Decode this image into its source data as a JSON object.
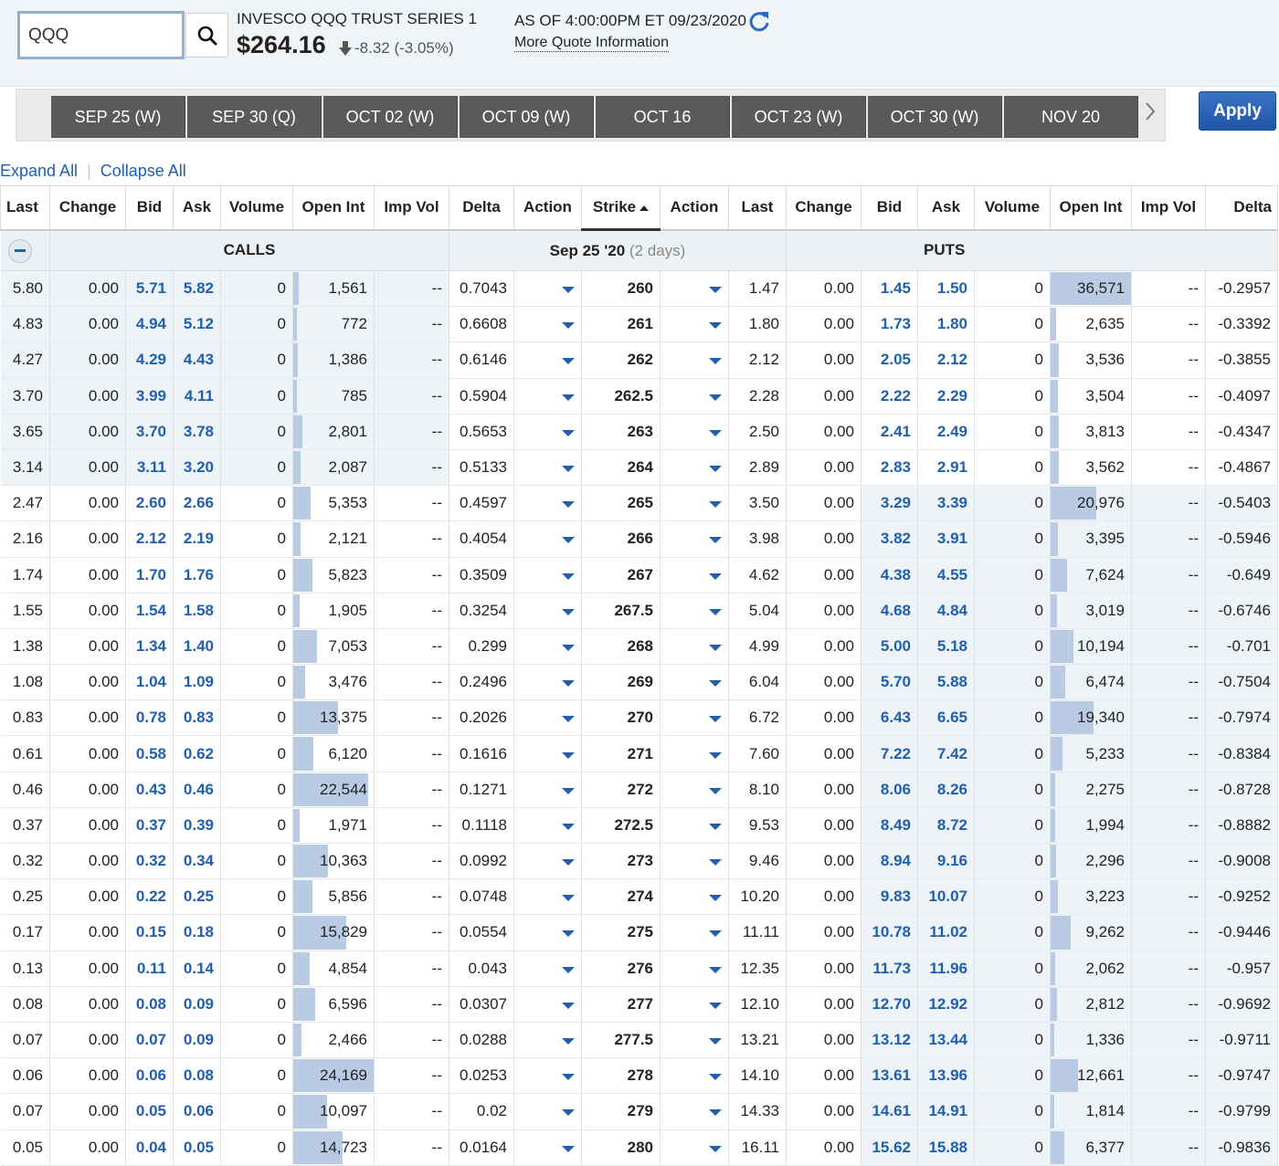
{
  "quote": {
    "symbol": "QQQ",
    "name": "INVESCO QQQ TRUST SERIES 1",
    "price": "$264.16",
    "change": "-8.32 (-3.05%)",
    "as_of": "AS OF 4:00:00PM ET 09/23/2020",
    "more_link": "More Quote Information"
  },
  "expirations": [
    "SEP 25 (W)",
    "SEP 30 (Q)",
    "OCT 02 (W)",
    "OCT 09 (W)",
    "OCT 16",
    "OCT 23 (W)",
    "OCT 30 (W)",
    "NOV 20"
  ],
  "apply_label": "Apply",
  "links": {
    "expand": "Expand All",
    "collapse": "Collapse All"
  },
  "columns": [
    "Last",
    "Change",
    "Bid",
    "Ask",
    "Volume",
    "Open Int",
    "Imp Vol",
    "Delta",
    "Action",
    "Strike",
    "Action",
    "Last",
    "Change",
    "Bid",
    "Ask",
    "Volume",
    "Open Int",
    "Imp Vol",
    "Delta"
  ],
  "group": {
    "calls": "CALLS",
    "puts": "PUTS",
    "expiry": "Sep 25 '20",
    "days": "(2 days)"
  },
  "rows": [
    {
      "strike": "260",
      "call": {
        "last": "5.80",
        "change": "0.00",
        "bid": "5.71",
        "ask": "5.82",
        "volume": "0",
        "oi": "1,561",
        "iv": "--",
        "delta": "0.7043"
      },
      "put": {
        "last": "1.47",
        "change": "0.00",
        "bid": "1.45",
        "ask": "1.50",
        "volume": "0",
        "oi": "36,571",
        "iv": "--",
        "delta": "-0.2957"
      }
    },
    {
      "strike": "261",
      "call": {
        "last": "4.83",
        "change": "0.00",
        "bid": "4.94",
        "ask": "5.12",
        "volume": "0",
        "oi": "772",
        "iv": "--",
        "delta": "0.6608"
      },
      "put": {
        "last": "1.80",
        "change": "0.00",
        "bid": "1.73",
        "ask": "1.80",
        "volume": "0",
        "oi": "2,635",
        "iv": "--",
        "delta": "-0.3392"
      }
    },
    {
      "strike": "262",
      "call": {
        "last": "4.27",
        "change": "0.00",
        "bid": "4.29",
        "ask": "4.43",
        "volume": "0",
        "oi": "1,386",
        "iv": "--",
        "delta": "0.6146"
      },
      "put": {
        "last": "2.12",
        "change": "0.00",
        "bid": "2.05",
        "ask": "2.12",
        "volume": "0",
        "oi": "3,536",
        "iv": "--",
        "delta": "-0.3855"
      }
    },
    {
      "strike": "262.5",
      "call": {
        "last": "3.70",
        "change": "0.00",
        "bid": "3.99",
        "ask": "4.11",
        "volume": "0",
        "oi": "785",
        "iv": "--",
        "delta": "0.5904"
      },
      "put": {
        "last": "2.28",
        "change": "0.00",
        "bid": "2.22",
        "ask": "2.29",
        "volume": "0",
        "oi": "3,504",
        "iv": "--",
        "delta": "-0.4097"
      }
    },
    {
      "strike": "263",
      "call": {
        "last": "3.65",
        "change": "0.00",
        "bid": "3.70",
        "ask": "3.78",
        "volume": "0",
        "oi": "2,801",
        "iv": "--",
        "delta": "0.5653"
      },
      "put": {
        "last": "2.50",
        "change": "0.00",
        "bid": "2.41",
        "ask": "2.49",
        "volume": "0",
        "oi": "3,813",
        "iv": "--",
        "delta": "-0.4347"
      }
    },
    {
      "strike": "264",
      "call": {
        "last": "3.14",
        "change": "0.00",
        "bid": "3.11",
        "ask": "3.20",
        "volume": "0",
        "oi": "2,087",
        "iv": "--",
        "delta": "0.5133"
      },
      "put": {
        "last": "2.89",
        "change": "0.00",
        "bid": "2.83",
        "ask": "2.91",
        "volume": "0",
        "oi": "3,562",
        "iv": "--",
        "delta": "-0.4867"
      }
    },
    {
      "strike": "265",
      "call": {
        "last": "2.47",
        "change": "0.00",
        "bid": "2.60",
        "ask": "2.66",
        "volume": "0",
        "oi": "5,353",
        "iv": "--",
        "delta": "0.4597"
      },
      "put": {
        "last": "3.50",
        "change": "0.00",
        "bid": "3.29",
        "ask": "3.39",
        "volume": "0",
        "oi": "20,976",
        "iv": "--",
        "delta": "-0.5403"
      }
    },
    {
      "strike": "266",
      "call": {
        "last": "2.16",
        "change": "0.00",
        "bid": "2.12",
        "ask": "2.19",
        "volume": "0",
        "oi": "2,121",
        "iv": "--",
        "delta": "0.4054"
      },
      "put": {
        "last": "3.98",
        "change": "0.00",
        "bid": "3.82",
        "ask": "3.91",
        "volume": "0",
        "oi": "3,395",
        "iv": "--",
        "delta": "-0.5946"
      }
    },
    {
      "strike": "267",
      "call": {
        "last": "1.74",
        "change": "0.00",
        "bid": "1.70",
        "ask": "1.76",
        "volume": "0",
        "oi": "5,823",
        "iv": "--",
        "delta": "0.3509"
      },
      "put": {
        "last": "4.62",
        "change": "0.00",
        "bid": "4.38",
        "ask": "4.55",
        "volume": "0",
        "oi": "7,624",
        "iv": "--",
        "delta": "-0.649"
      }
    },
    {
      "strike": "267.5",
      "call": {
        "last": "1.55",
        "change": "0.00",
        "bid": "1.54",
        "ask": "1.58",
        "volume": "0",
        "oi": "1,905",
        "iv": "--",
        "delta": "0.3254"
      },
      "put": {
        "last": "5.04",
        "change": "0.00",
        "bid": "4.68",
        "ask": "4.84",
        "volume": "0",
        "oi": "3,019",
        "iv": "--",
        "delta": "-0.6746"
      }
    },
    {
      "strike": "268",
      "call": {
        "last": "1.38",
        "change": "0.00",
        "bid": "1.34",
        "ask": "1.40",
        "volume": "0",
        "oi": "7,053",
        "iv": "--",
        "delta": "0.299"
      },
      "put": {
        "last": "4.99",
        "change": "0.00",
        "bid": "5.00",
        "ask": "5.18",
        "volume": "0",
        "oi": "10,194",
        "iv": "--",
        "delta": "-0.701"
      }
    },
    {
      "strike": "269",
      "call": {
        "last": "1.08",
        "change": "0.00",
        "bid": "1.04",
        "ask": "1.09",
        "volume": "0",
        "oi": "3,476",
        "iv": "--",
        "delta": "0.2496"
      },
      "put": {
        "last": "6.04",
        "change": "0.00",
        "bid": "5.70",
        "ask": "5.88",
        "volume": "0",
        "oi": "6,474",
        "iv": "--",
        "delta": "-0.7504"
      }
    },
    {
      "strike": "270",
      "call": {
        "last": "0.83",
        "change": "0.00",
        "bid": "0.78",
        "ask": "0.83",
        "volume": "0",
        "oi": "13,375",
        "iv": "--",
        "delta": "0.2026"
      },
      "put": {
        "last": "6.72",
        "change": "0.00",
        "bid": "6.43",
        "ask": "6.65",
        "volume": "0",
        "oi": "19,340",
        "iv": "--",
        "delta": "-0.7974"
      }
    },
    {
      "strike": "271",
      "call": {
        "last": "0.61",
        "change": "0.00",
        "bid": "0.58",
        "ask": "0.62",
        "volume": "0",
        "oi": "6,120",
        "iv": "--",
        "delta": "0.1616"
      },
      "put": {
        "last": "7.60",
        "change": "0.00",
        "bid": "7.22",
        "ask": "7.42",
        "volume": "0",
        "oi": "5,233",
        "iv": "--",
        "delta": "-0.8384"
      }
    },
    {
      "strike": "272",
      "call": {
        "last": "0.46",
        "change": "0.00",
        "bid": "0.43",
        "ask": "0.46",
        "volume": "0",
        "oi": "22,544",
        "iv": "--",
        "delta": "0.1271"
      },
      "put": {
        "last": "8.10",
        "change": "0.00",
        "bid": "8.06",
        "ask": "8.26",
        "volume": "0",
        "oi": "2,275",
        "iv": "--",
        "delta": "-0.8728"
      }
    },
    {
      "strike": "272.5",
      "call": {
        "last": "0.37",
        "change": "0.00",
        "bid": "0.37",
        "ask": "0.39",
        "volume": "0",
        "oi": "1,971",
        "iv": "--",
        "delta": "0.1118"
      },
      "put": {
        "last": "9.53",
        "change": "0.00",
        "bid": "8.49",
        "ask": "8.72",
        "volume": "0",
        "oi": "1,994",
        "iv": "--",
        "delta": "-0.8882"
      }
    },
    {
      "strike": "273",
      "call": {
        "last": "0.32",
        "change": "0.00",
        "bid": "0.32",
        "ask": "0.34",
        "volume": "0",
        "oi": "10,363",
        "iv": "--",
        "delta": "0.0992"
      },
      "put": {
        "last": "9.46",
        "change": "0.00",
        "bid": "8.94",
        "ask": "9.16",
        "volume": "0",
        "oi": "2,296",
        "iv": "--",
        "delta": "-0.9008"
      }
    },
    {
      "strike": "274",
      "call": {
        "last": "0.25",
        "change": "0.00",
        "bid": "0.22",
        "ask": "0.25",
        "volume": "0",
        "oi": "5,856",
        "iv": "--",
        "delta": "0.0748"
      },
      "put": {
        "last": "10.20",
        "change": "0.00",
        "bid": "9.83",
        "ask": "10.07",
        "volume": "0",
        "oi": "3,223",
        "iv": "--",
        "delta": "-0.9252"
      }
    },
    {
      "strike": "275",
      "call": {
        "last": "0.17",
        "change": "0.00",
        "bid": "0.15",
        "ask": "0.18",
        "volume": "0",
        "oi": "15,829",
        "iv": "--",
        "delta": "0.0554"
      },
      "put": {
        "last": "11.11",
        "change": "0.00",
        "bid": "10.78",
        "ask": "11.02",
        "volume": "0",
        "oi": "9,262",
        "iv": "--",
        "delta": "-0.9446"
      }
    },
    {
      "strike": "276",
      "call": {
        "last": "0.13",
        "change": "0.00",
        "bid": "0.11",
        "ask": "0.14",
        "volume": "0",
        "oi": "4,854",
        "iv": "--",
        "delta": "0.043"
      },
      "put": {
        "last": "12.35",
        "change": "0.00",
        "bid": "11.73",
        "ask": "11.96",
        "volume": "0",
        "oi": "2,062",
        "iv": "--",
        "delta": "-0.957"
      }
    },
    {
      "strike": "277",
      "call": {
        "last": "0.08",
        "change": "0.00",
        "bid": "0.08",
        "ask": "0.09",
        "volume": "0",
        "oi": "6,596",
        "iv": "--",
        "delta": "0.0307"
      },
      "put": {
        "last": "12.10",
        "change": "0.00",
        "bid": "12.70",
        "ask": "12.92",
        "volume": "0",
        "oi": "2,812",
        "iv": "--",
        "delta": "-0.9692"
      }
    },
    {
      "strike": "277.5",
      "call": {
        "last": "0.07",
        "change": "0.00",
        "bid": "0.07",
        "ask": "0.09",
        "volume": "0",
        "oi": "2,466",
        "iv": "--",
        "delta": "0.0288"
      },
      "put": {
        "last": "13.21",
        "change": "0.00",
        "bid": "13.12",
        "ask": "13.44",
        "volume": "0",
        "oi": "1,336",
        "iv": "--",
        "delta": "-0.9711"
      }
    },
    {
      "strike": "278",
      "call": {
        "last": "0.06",
        "change": "0.00",
        "bid": "0.06",
        "ask": "0.08",
        "volume": "0",
        "oi": "24,169",
        "iv": "--",
        "delta": "0.0253"
      },
      "put": {
        "last": "14.10",
        "change": "0.00",
        "bid": "13.61",
        "ask": "13.96",
        "volume": "0",
        "oi": "12,661",
        "iv": "--",
        "delta": "-0.9747"
      }
    },
    {
      "strike": "279",
      "call": {
        "last": "0.07",
        "change": "0.00",
        "bid": "0.05",
        "ask": "0.06",
        "volume": "0",
        "oi": "10,097",
        "iv": "--",
        "delta": "0.02"
      },
      "put": {
        "last": "14.33",
        "change": "0.00",
        "bid": "14.61",
        "ask": "14.91",
        "volume": "0",
        "oi": "1,814",
        "iv": "--",
        "delta": "-0.9799"
      }
    },
    {
      "strike": "280",
      "call": {
        "last": "0.05",
        "change": "0.00",
        "bid": "0.04",
        "ask": "0.05",
        "volume": "0",
        "oi": "14,723",
        "iv": "--",
        "delta": "0.0164"
      },
      "put": {
        "last": "16.11",
        "change": "0.00",
        "bid": "15.62",
        "ask": "15.88",
        "volume": "0",
        "oi": "6,377",
        "iv": "--",
        "delta": "-0.9836"
      }
    }
  ],
  "colors": {
    "link": "#1f5fae",
    "itm_shade": "#eef3f8",
    "oi_bar": "#b8cbe3",
    "tab_bg": "#5a5a5a",
    "apply_bg": "#2a64b8"
  }
}
